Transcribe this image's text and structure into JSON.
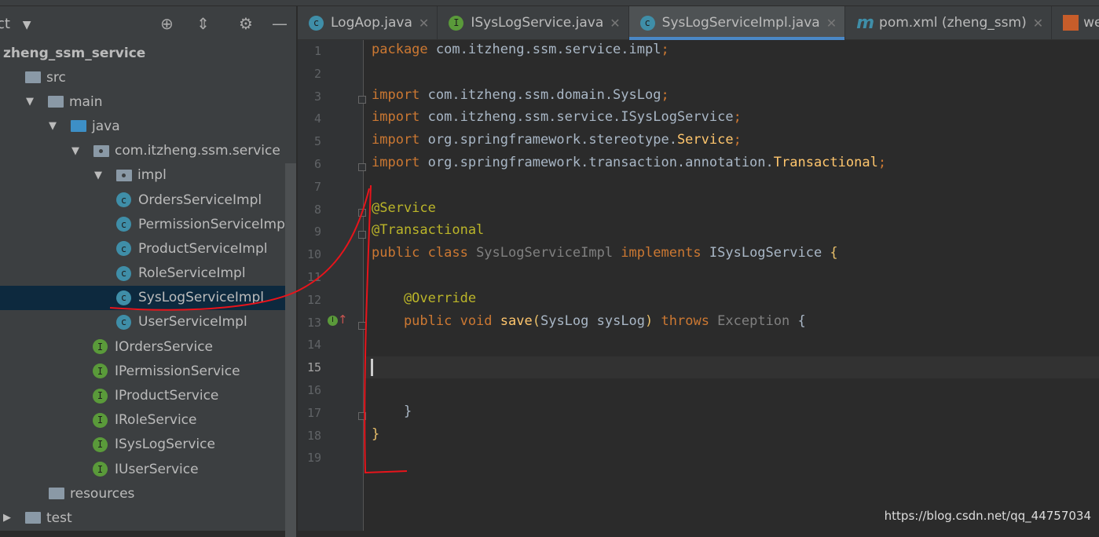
{
  "sidebar": {
    "title": "ct",
    "project": "zheng_ssm_service",
    "tree": [
      {
        "label": "src",
        "indent": 0,
        "type": "folder",
        "arrow": ""
      },
      {
        "label": "main",
        "indent": 1,
        "type": "folder",
        "arrow": "▼"
      },
      {
        "label": "java",
        "indent": 2,
        "type": "folder-blue",
        "arrow": "▼"
      },
      {
        "label": "com.itzheng.ssm.service",
        "indent": 3,
        "type": "package",
        "arrow": "▼"
      },
      {
        "label": "impl",
        "indent": 4,
        "type": "package",
        "arrow": "▼"
      },
      {
        "label": "OrdersServiceImpl",
        "indent": 5,
        "type": "class"
      },
      {
        "label": "PermissionServiceImp",
        "indent": 5,
        "type": "class"
      },
      {
        "label": "ProductServiceImpl",
        "indent": 5,
        "type": "class"
      },
      {
        "label": "RoleServiceImpl",
        "indent": 5,
        "type": "class"
      },
      {
        "label": "SysLogServiceImpl",
        "indent": 5,
        "type": "class",
        "selected": true
      },
      {
        "label": "UserServiceImpl",
        "indent": 5,
        "type": "class"
      },
      {
        "label": "IOrdersService",
        "indent": 4,
        "type": "interface"
      },
      {
        "label": "IPermissionService",
        "indent": 4,
        "type": "interface"
      },
      {
        "label": "IProductService",
        "indent": 4,
        "type": "interface"
      },
      {
        "label": "IRoleService",
        "indent": 4,
        "type": "interface"
      },
      {
        "label": "ISysLogService",
        "indent": 4,
        "type": "interface"
      },
      {
        "label": "IUserService",
        "indent": 4,
        "type": "interface"
      },
      {
        "label": "resources",
        "indent": 2,
        "type": "resources"
      },
      {
        "label": "test",
        "indent": 0,
        "type": "folder",
        "arrow": "▶"
      }
    ]
  },
  "tabs": [
    {
      "label": "LogAop.java",
      "icon": "C",
      "kind": "class"
    },
    {
      "label": "ISysLogService.java",
      "icon": "I",
      "kind": "interface"
    },
    {
      "label": "SysLogServiceImpl.java",
      "icon": "C",
      "kind": "class",
      "active": true
    },
    {
      "label": "pom.xml (zheng_ssm)",
      "icon": "m",
      "kind": "maven"
    },
    {
      "label": "web.x",
      "icon": "web",
      "kind": "web"
    }
  ],
  "editor": {
    "current_line": 15,
    "lines": [
      [
        [
          "package ",
          "k"
        ],
        [
          "com.itzheng.ssm.service.impl",
          "t"
        ],
        [
          ";",
          "k"
        ]
      ],
      [],
      [
        [
          "import ",
          "k"
        ],
        [
          "com.itzheng.ssm.domain.SysLog",
          "t"
        ],
        [
          ";",
          "k"
        ]
      ],
      [
        [
          "import ",
          "k"
        ],
        [
          "com.itzheng.ssm.service.ISysLogService",
          "t"
        ],
        [
          ";",
          "k"
        ]
      ],
      [
        [
          "import ",
          "k"
        ],
        [
          "org.springframework.stereotype.",
          "t"
        ],
        [
          "Service",
          "m"
        ],
        [
          ";",
          "k"
        ]
      ],
      [
        [
          "import ",
          "k"
        ],
        [
          "org.springframework.transaction.annotation.",
          "t"
        ],
        [
          "Transactional",
          "m"
        ],
        [
          ";",
          "k"
        ]
      ],
      [],
      [
        [
          "@Service",
          "a"
        ]
      ],
      [
        [
          "@Transactional",
          "a"
        ]
      ],
      [
        [
          "public class ",
          "k"
        ],
        [
          "SysLogServiceImpl ",
          "g"
        ],
        [
          "implements ",
          "k"
        ],
        [
          "ISysLogService ",
          "t"
        ],
        [
          "{",
          "b"
        ]
      ],
      [],
      [
        [
          "    @Override",
          "a"
        ]
      ],
      [
        [
          "    public void ",
          "k"
        ],
        [
          "save",
          "m"
        ],
        [
          "(",
          "b"
        ],
        [
          "SysLog sysLog",
          "t"
        ],
        [
          ") ",
          "b"
        ],
        [
          "throws ",
          "k"
        ],
        [
          "Exception ",
          "g"
        ],
        [
          "{",
          "p"
        ]
      ],
      [],
      [],
      [],
      [
        [
          "    }",
          "p"
        ]
      ],
      [
        [
          "}",
          "b"
        ]
      ],
      []
    ]
  },
  "watermark": "https://blog.csdn.net/qq_44757034",
  "colors": {
    "keyword": "#cc7832",
    "annotation": "#bbb529",
    "accent": "#4a88c7",
    "annotation_pen": "#e8141b"
  }
}
